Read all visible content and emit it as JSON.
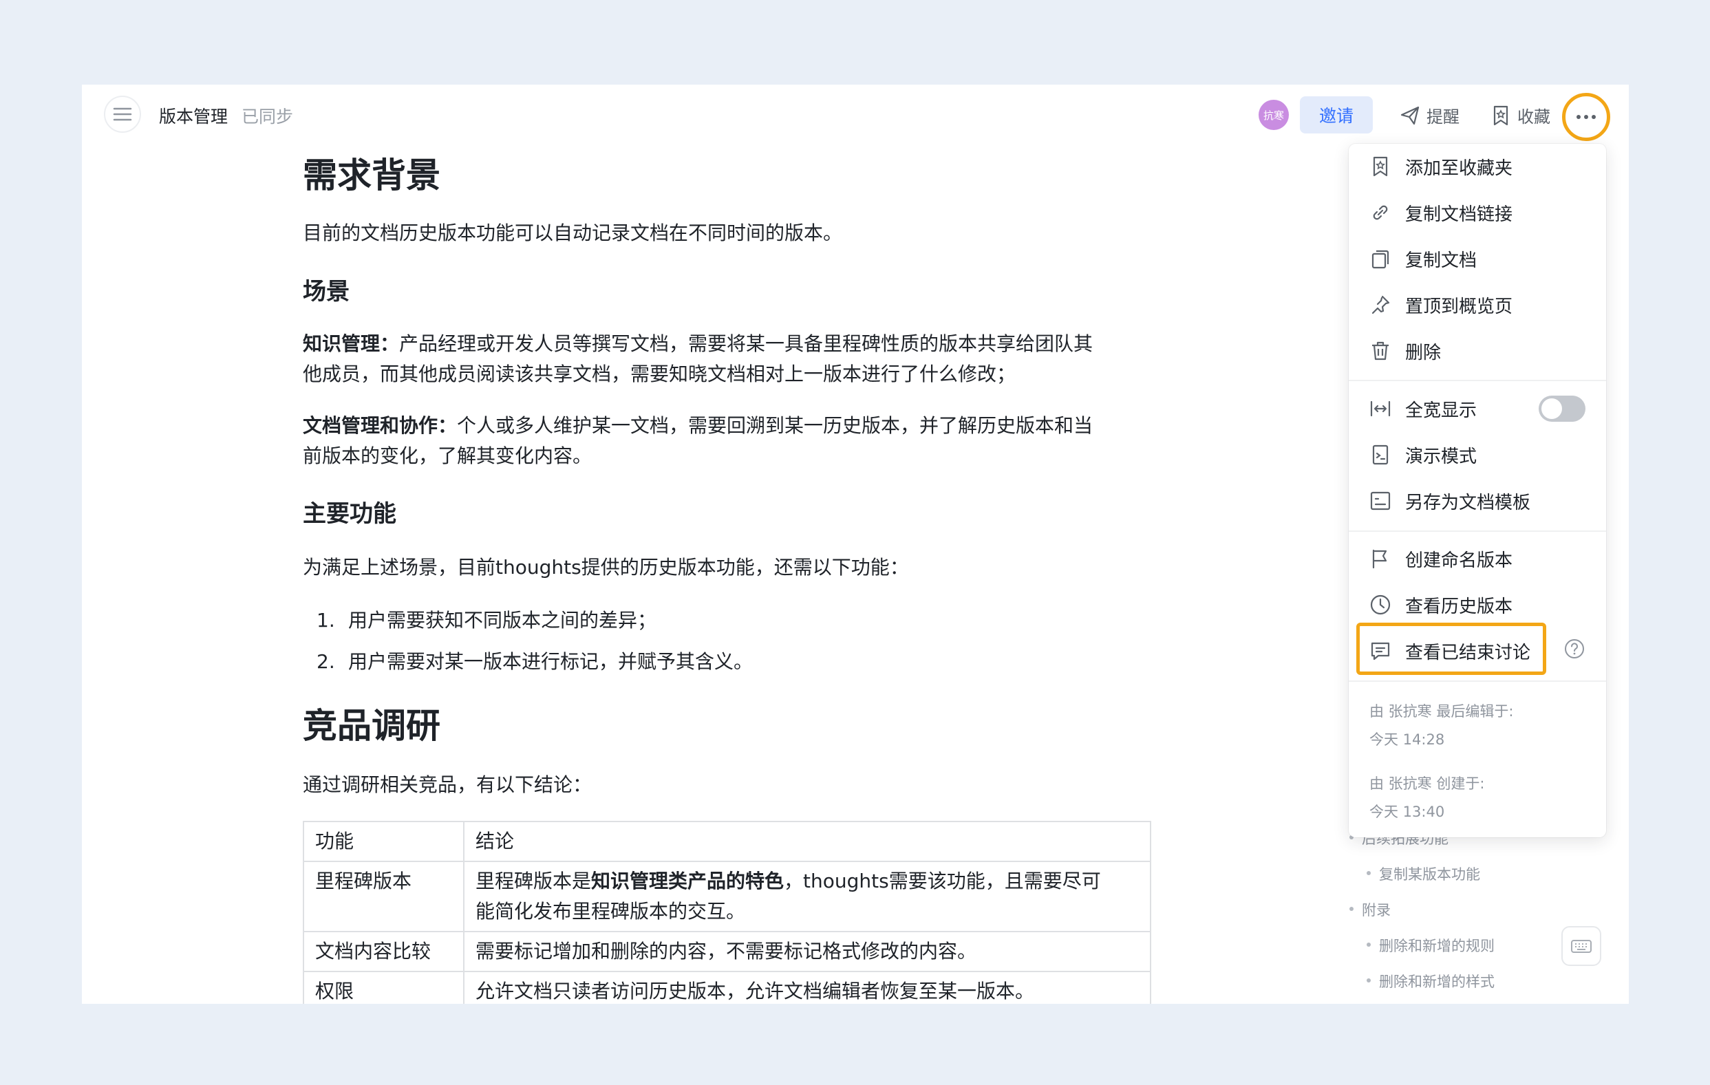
{
  "header": {
    "doc_title": "版本管理",
    "sync_status": "已同步",
    "avatar_text": "抗寒",
    "invite_label": "邀请",
    "remind_label": "提醒",
    "favorite_label": "收藏"
  },
  "doc": {
    "h_background": "需求背景",
    "p_intro": "目前的文档历史版本功能可以自动记录文档在不同时间的版本。",
    "h_scenario": "场景",
    "s1_bold": "知识管理：",
    "s1_text_line1": "产品经理或开发人员等撰写文档，需要将某一具备里程碑性质的版本共享给团队其",
    "s1_text_line2": "他成员，而其他成员阅读该共享文档，需要知晓文档相对上一版本进行了什么修改；",
    "s2_bold": "文档管理和协作：",
    "s2_text_line1": "个人或多人维护某一文档，需要回溯到某一历史版本，并了解历史版本和当",
    "s2_text_line2": "前版本的变化，了解其变化内容。",
    "h_features": "主要功能",
    "p_features": "为满足上述场景，目前thoughts提供的历史版本功能，还需以下功能：",
    "list": [
      {
        "num": "1.",
        "text": "用户需要获知不同版本之间的差异；"
      },
      {
        "num": "2.",
        "text": "用户需要对某一版本进行标记，并赋予其含义。"
      }
    ],
    "h_research": "竞品调研",
    "p_research": "通过调研相关竞品，有以下结论：",
    "table": {
      "header": [
        "功能",
        "结论"
      ],
      "r1_c1": "里程碑版本",
      "r1_c2_a": "里程碑版本是",
      "r1_c2_b": "知识管理类产品的特色",
      "r1_c2_c": "，thoughts需要该功能，且需要尽可",
      "r1_c2_d": "能简化发布里程碑版本的交互。",
      "r2_c1": "文档内容比较",
      "r2_c2": "需要标记增加和删除的内容，不需要标记格式修改的内容。",
      "r3_c1": "权限",
      "r3_c2": "允许文档只读者访问历史版本，允许文档编辑者恢复至某一版本。"
    }
  },
  "outline": {
    "items": [
      "后续拓展功能",
      "复制某版本功能",
      "附录",
      "删除和新增的规则",
      "删除和新增的样式"
    ]
  },
  "menu": {
    "add_favorite": "添加至收藏夹",
    "copy_link": "复制文档链接",
    "copy_doc": "复制文档",
    "pin_overview": "置顶到概览页",
    "delete": "删除",
    "full_width": "全宽显示",
    "full_width_on": false,
    "present": "演示模式",
    "save_template": "另存为文档模板",
    "create_named_version": "创建命名版本",
    "view_history": "查看历史版本",
    "view_closed_discussions": "查看已结束讨论",
    "last_edited_by": "由 张抗寒 最后编辑于:",
    "last_edited_time": "今天 14:28",
    "created_by": "由 张抗寒 创建于:",
    "created_time": "今天 13:40"
  },
  "colors": {
    "accent": "#3370ff",
    "highlight": "#f3a616",
    "avatar": "#c98de1",
    "background": "#e9eff7"
  }
}
